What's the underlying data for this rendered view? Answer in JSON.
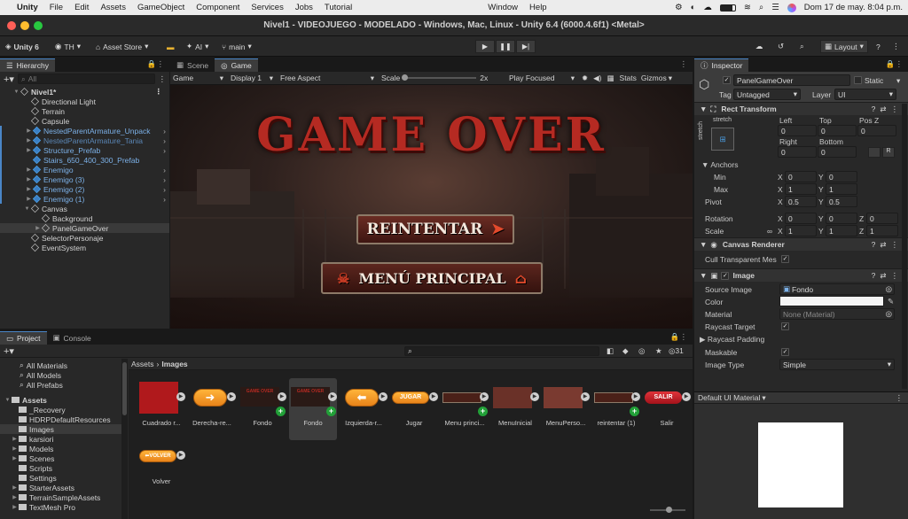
{
  "menubar": {
    "app": "Unity",
    "items": [
      "File",
      "Edit",
      "Assets",
      "GameObject",
      "Component",
      "Services",
      "Jobs",
      "Tutorial"
    ],
    "window": "Window",
    "help": "Help",
    "clock": "Dom 17 de may.  8:04 p.m."
  },
  "titlebar": {
    "title": "Nivel1 - VIDEOJUEGO - MODELADO - Windows, Mac, Linux - Unity 6.4 (6000.4.6f1) <Metal>"
  },
  "toolbar": {
    "unity": "Unity 6",
    "account": "TH",
    "asset_store": "Asset Store",
    "ai": "AI",
    "branch": "main",
    "layout": "Layout"
  },
  "hierarchy": {
    "tab": "Hierarchy",
    "search_placeholder": "All",
    "scene": "Nivel1*",
    "items": [
      {
        "label": "Directional Light",
        "indent": 2,
        "type": "obj"
      },
      {
        "label": "Terrain",
        "indent": 2,
        "type": "obj"
      },
      {
        "label": "Capsule",
        "indent": 2,
        "type": "obj"
      },
      {
        "label": "NestedParentArmature_Unpack",
        "indent": 2,
        "type": "prefab",
        "arrow": true,
        "more": true
      },
      {
        "label": "NestedParentArmature_Tania",
        "indent": 2,
        "type": "prefab-dim",
        "arrow": true,
        "more": true
      },
      {
        "label": "Structure_Prefab",
        "indent": 2,
        "type": "prefab",
        "arrow": true,
        "more": true
      },
      {
        "label": "Stairs_650_400_300_Prefab",
        "indent": 2,
        "type": "prefab"
      },
      {
        "label": "Enemigo",
        "indent": 2,
        "type": "prefab",
        "arrow": true,
        "more": true
      },
      {
        "label": "Enemigo (3)",
        "indent": 2,
        "type": "prefab",
        "arrow": true,
        "more": true
      },
      {
        "label": "Enemigo (2)",
        "indent": 2,
        "type": "prefab",
        "arrow": true,
        "more": true
      },
      {
        "label": "Enemigo (1)",
        "indent": 2,
        "type": "prefab",
        "arrow": true,
        "more": true
      },
      {
        "label": "Canvas",
        "indent": 2,
        "type": "obj",
        "arrow": "open"
      },
      {
        "label": "Background",
        "indent": 3,
        "type": "obj"
      },
      {
        "label": "PanelGameOver",
        "indent": 3,
        "type": "obj",
        "arrow": true,
        "selected": true
      },
      {
        "label": "SelectorPersonaje",
        "indent": 2,
        "type": "obj"
      },
      {
        "label": "EventSystem",
        "indent": 2,
        "type": "obj"
      }
    ]
  },
  "scene_tabs": {
    "scene": "Scene",
    "game": "Game"
  },
  "game_bar": {
    "game": "Game",
    "display": "Display 1",
    "aspect": "Free Aspect",
    "scale_label": "Scale",
    "scale_value": "2x",
    "play_focused": "Play Focused",
    "stats": "Stats",
    "gizmos": "Gizmos"
  },
  "game_view": {
    "title": "GAME OVER",
    "btn_retry": "REINTENTAR",
    "btn_menu": "MENÚ PRINCIPAL"
  },
  "project": {
    "tab_project": "Project",
    "tab_console": "Console",
    "favorites": [
      "All Materials",
      "All Models",
      "All Prefabs"
    ],
    "assets_root": "Assets",
    "folders": [
      "_Recovery",
      "HDRPDefaultResources",
      "Images",
      "karsiori",
      "Models",
      "Scenes",
      "Scripts",
      "Settings",
      "StarterAssets",
      "TerrainSampleAssets",
      "TextMesh Pro"
    ],
    "breadcrumb_root": "Assets",
    "breadcrumb_current": "Images",
    "badge_count": "31",
    "items": [
      {
        "name": "Cuadrado r...",
        "kind": "red"
      },
      {
        "name": "Derecha-re...",
        "kind": "arrow-right"
      },
      {
        "name": "Fondo",
        "kind": "fondo"
      },
      {
        "name": "Fondo",
        "kind": "fondo-sel"
      },
      {
        "name": "Izquierda-r...",
        "kind": "arrow-left"
      },
      {
        "name": "Jugar",
        "kind": "jugar"
      },
      {
        "name": "Menu princi...",
        "kind": "menu"
      },
      {
        "name": "MenuInicial",
        "kind": "dark"
      },
      {
        "name": "MenuPerso...",
        "kind": "dark2"
      },
      {
        "name": "reintentar (1)",
        "kind": "reint"
      },
      {
        "name": "Salir",
        "kind": "salir"
      },
      {
        "name": "Volver",
        "kind": "volver"
      }
    ],
    "thumb_texts": {
      "jugar": "JUGAR",
      "salir": "SALIR",
      "volver": "VOLVER",
      "fondo": "GAME OVER"
    }
  },
  "inspector": {
    "tab": "Inspector",
    "object_name": "PanelGameOver",
    "static": "Static",
    "tag_label": "Tag",
    "tag_value": "Untagged",
    "layer_label": "Layer",
    "layer_value": "UI",
    "rect_transform": "Rect Transform",
    "stretch_top": "stretch",
    "stretch_side": "stretch",
    "rt_labels": {
      "left": "Left",
      "top": "Top",
      "posz": "Pos Z",
      "right": "Right",
      "bottom": "Bottom"
    },
    "rt_values": {
      "left": "0",
      "top": "0",
      "posz": "0",
      "right": "0",
      "bottom": "0"
    },
    "anchors": "Anchors",
    "min": "Min",
    "max": "Max",
    "pivot": "Pivot",
    "anchor_min": {
      "x": "0",
      "y": "0"
    },
    "anchor_max": {
      "x": "1",
      "y": "1"
    },
    "pivot_v": {
      "x": "0.5",
      "y": "0.5"
    },
    "rotation": "Rotation",
    "rotation_v": {
      "x": "0",
      "y": "0",
      "z": "0"
    },
    "scale": "Scale",
    "scale_v": {
      "x": "1",
      "y": "1",
      "z": "1"
    },
    "canvas_renderer": "Canvas Renderer",
    "cull": "Cull Transparent Mes",
    "image": "Image",
    "source_image": "Source Image",
    "source_value": "Fondo",
    "color": "Color",
    "material": "Material",
    "material_value": "None (Material)",
    "raycast_target": "Raycast Target",
    "raycast_padding": "Raycast Padding",
    "maskable": "Maskable",
    "image_type": "Image Type",
    "image_type_value": "Simple",
    "preview_label": "Default UI Material"
  },
  "colors": {
    "accent": "#4a86c7",
    "selected": "#2c5d87",
    "prefab": "#7cb1e8",
    "gameover_red": "#b52a22"
  }
}
